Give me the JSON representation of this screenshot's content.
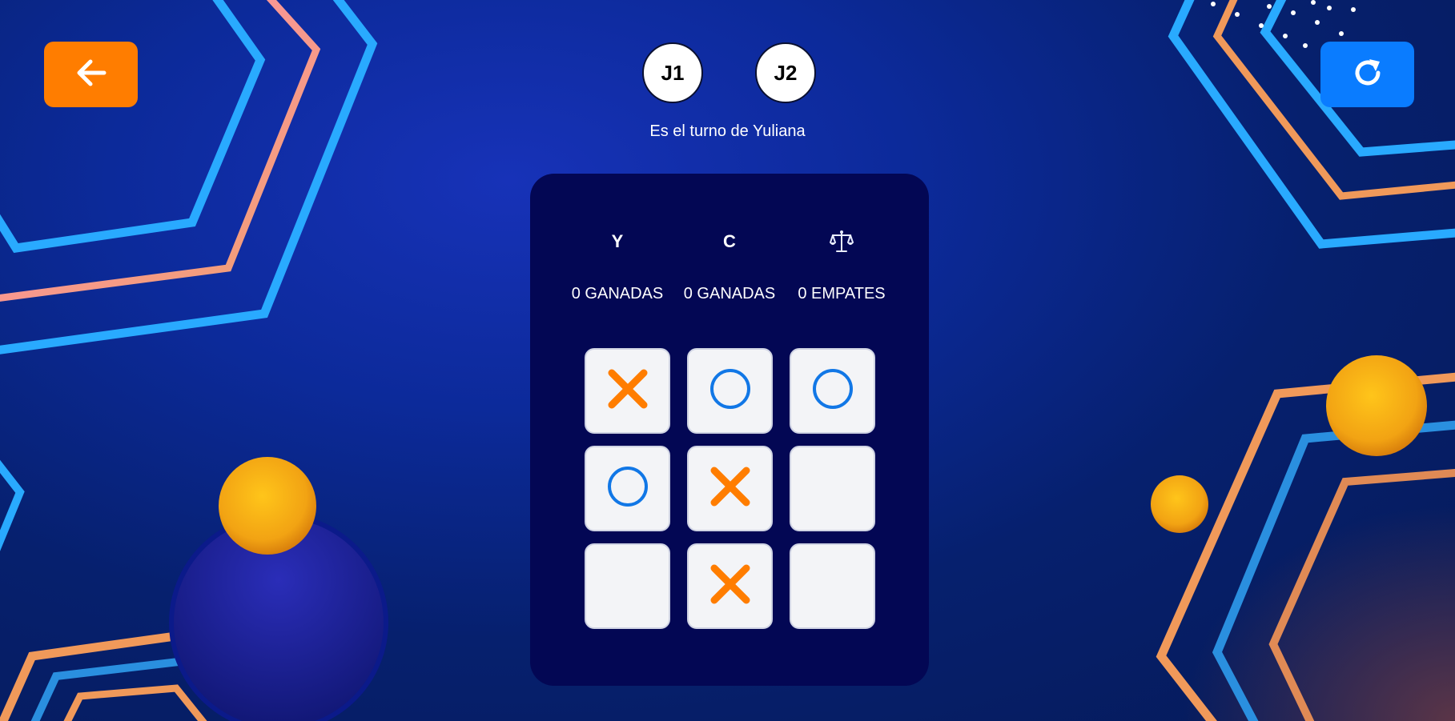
{
  "players": {
    "p1": "J1",
    "p2": "J2"
  },
  "turn_text": "Es el turno de Yuliana",
  "scoreboard": {
    "headers": [
      "Y",
      "C"
    ],
    "tie_icon": "scales-icon",
    "values": [
      "0 GANADAS",
      "0 GANADAS",
      "0 EMPATES"
    ]
  },
  "board": [
    [
      "X",
      "O",
      "O"
    ],
    [
      "O",
      "X",
      ""
    ],
    [
      "",
      "X",
      ""
    ]
  ],
  "buttons": {
    "back_icon": "arrow-left-icon",
    "reset_icon": "refresh-icon"
  },
  "colors": {
    "back_button": "#ff7d00",
    "reset_button": "#0a7cff",
    "x_mark": "#ff7d00",
    "o_mark": "#1177e6",
    "panel": "#030754"
  }
}
